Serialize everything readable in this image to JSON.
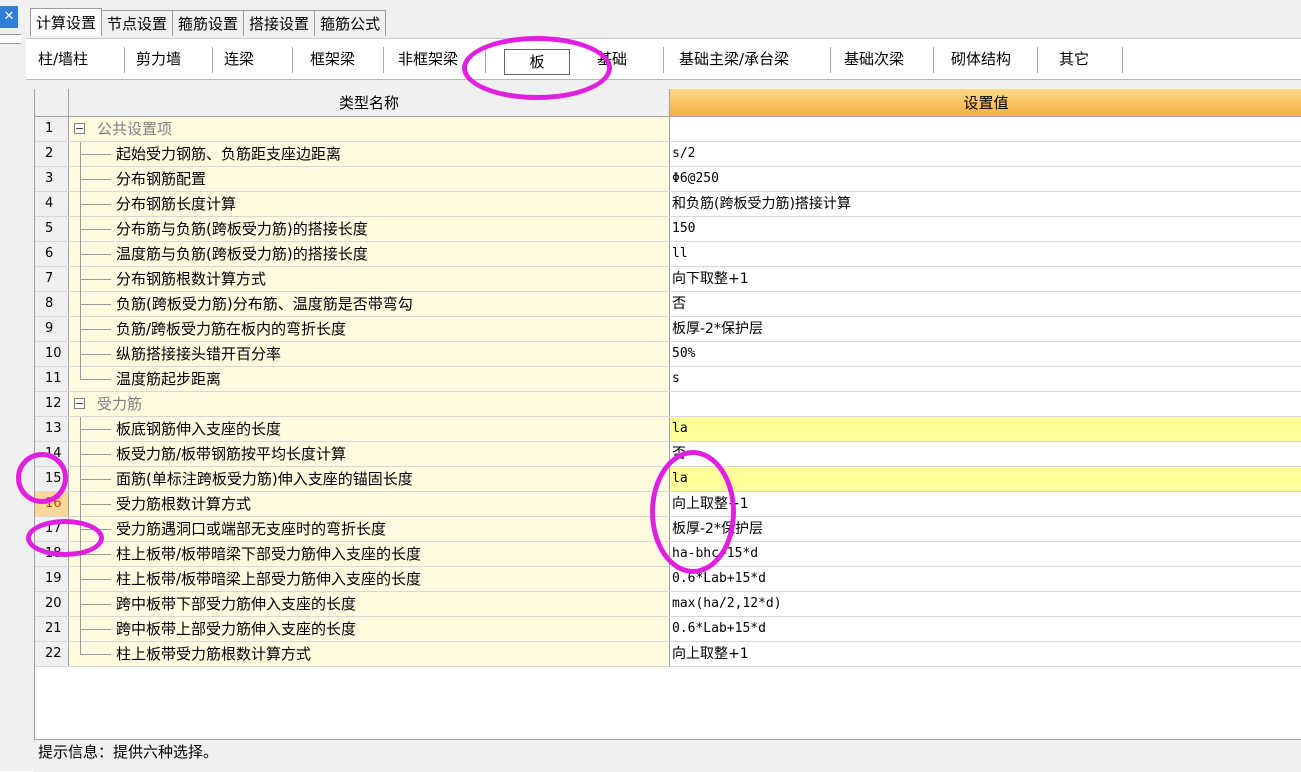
{
  "window": {
    "close_glyph": "✕"
  },
  "top_tabs": [
    {
      "label": "计算设置",
      "active": true
    },
    {
      "label": "节点设置"
    },
    {
      "label": "箍筋设置"
    },
    {
      "label": "搭接设置"
    },
    {
      "label": "箍筋公式"
    }
  ],
  "sub_tabs": [
    {
      "label": "柱/墙柱"
    },
    {
      "label": "剪力墙"
    },
    {
      "label": "连梁"
    },
    {
      "label": "框架梁"
    },
    {
      "label": "非框架梁"
    },
    {
      "label": "板",
      "selected": true
    },
    {
      "label": "基础"
    },
    {
      "label": "基础主梁/承台梁"
    },
    {
      "label": "基础次梁"
    },
    {
      "label": "砌体结构"
    },
    {
      "label": "其它"
    }
  ],
  "grid": {
    "header_name": "类型名称",
    "header_value": "设置值",
    "rows": [
      {
        "num": "1",
        "name": "公共设置项",
        "value": "",
        "group": true
      },
      {
        "num": "2",
        "name": "起始受力钢筋、负筋距支座边距离",
        "value": "s/2"
      },
      {
        "num": "3",
        "name": "分布钢筋配置",
        "value": "Φ6@250"
      },
      {
        "num": "4",
        "name": "分布钢筋长度计算",
        "value": "和负筋(跨板受力筋)搭接计算"
      },
      {
        "num": "5",
        "name": "分布筋与负筋(跨板受力筋)的搭接长度",
        "value": "150"
      },
      {
        "num": "6",
        "name": "温度筋与负筋(跨板受力筋)的搭接长度",
        "value": "ll"
      },
      {
        "num": "7",
        "name": "分布钢筋根数计算方式",
        "value": "向下取整+1"
      },
      {
        "num": "8",
        "name": "负筋(跨板受力筋)分布筋、温度筋是否带弯勾",
        "value": "否"
      },
      {
        "num": "9",
        "name": "负筋/跨板受力筋在板内的弯折长度",
        "value": "板厚-2*保护层"
      },
      {
        "num": "10",
        "name": "纵筋搭接接头错开百分率",
        "value": "50%"
      },
      {
        "num": "11",
        "name": "温度筋起步距离",
        "value": "s"
      },
      {
        "num": "12",
        "name": "受力筋",
        "value": "",
        "group": true
      },
      {
        "num": "13",
        "name": "板底钢筋伸入支座的长度",
        "value": "la",
        "highlight": true
      },
      {
        "num": "14",
        "name": "板受力筋/板带钢筋按平均长度计算",
        "value": "否"
      },
      {
        "num": "15",
        "name": "面筋(单标注跨板受力筋)伸入支座的锚固长度",
        "value": "la",
        "highlight": true
      },
      {
        "num": "16",
        "name": "受力筋根数计算方式",
        "value": "向上取整+1",
        "current": true
      },
      {
        "num": "17",
        "name": "受力筋遇洞口或端部无支座时的弯折长度",
        "value": "板厚-2*保护层"
      },
      {
        "num": "18",
        "name": "柱上板带/板带暗梁下部受力筋伸入支座的长度",
        "value": "ha-bhc+15*d"
      },
      {
        "num": "19",
        "name": "柱上板带/板带暗梁上部受力筋伸入支座的长度",
        "value": "0.6*Lab+15*d"
      },
      {
        "num": "20",
        "name": "跨中板带下部受力筋伸入支座的长度",
        "value": "max(ha/2,12*d)"
      },
      {
        "num": "21",
        "name": "跨中板带上部受力筋伸入支座的长度",
        "value": "0.6*Lab+15*d"
      },
      {
        "num": "22",
        "name": "柱上板带受力筋根数计算方式",
        "value": "向上取整+1"
      }
    ]
  },
  "status": {
    "text": "提示信息：提供六种选择。"
  },
  "colors": {
    "annotation": "#e020e0",
    "highlight_cell": "#ffff99",
    "header_value_bg": "#f5b23f"
  }
}
